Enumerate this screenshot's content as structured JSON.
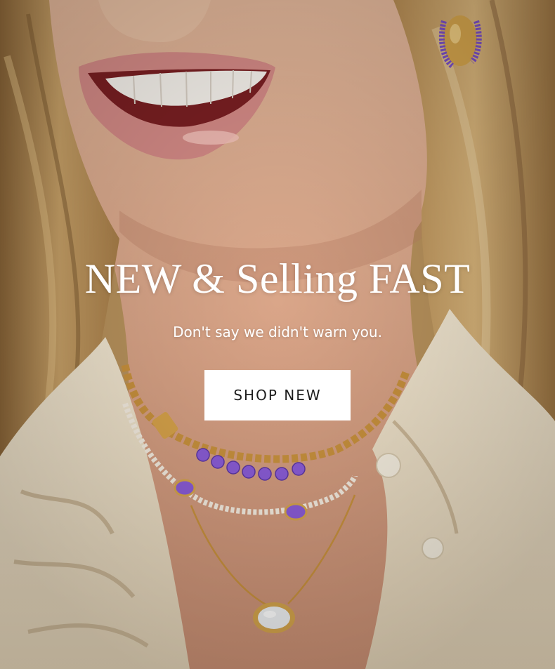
{
  "hero": {
    "headline": "NEW & Selling FAST",
    "subline": "Don't say we didn't warn you.",
    "cta_label": "SHOP NEW"
  },
  "colors": {
    "text": "#ffffff",
    "button_bg": "#ffffff",
    "button_text": "#1d1d1d",
    "gem_purple": "#8a5cd6",
    "gold": "#d4a44c"
  }
}
